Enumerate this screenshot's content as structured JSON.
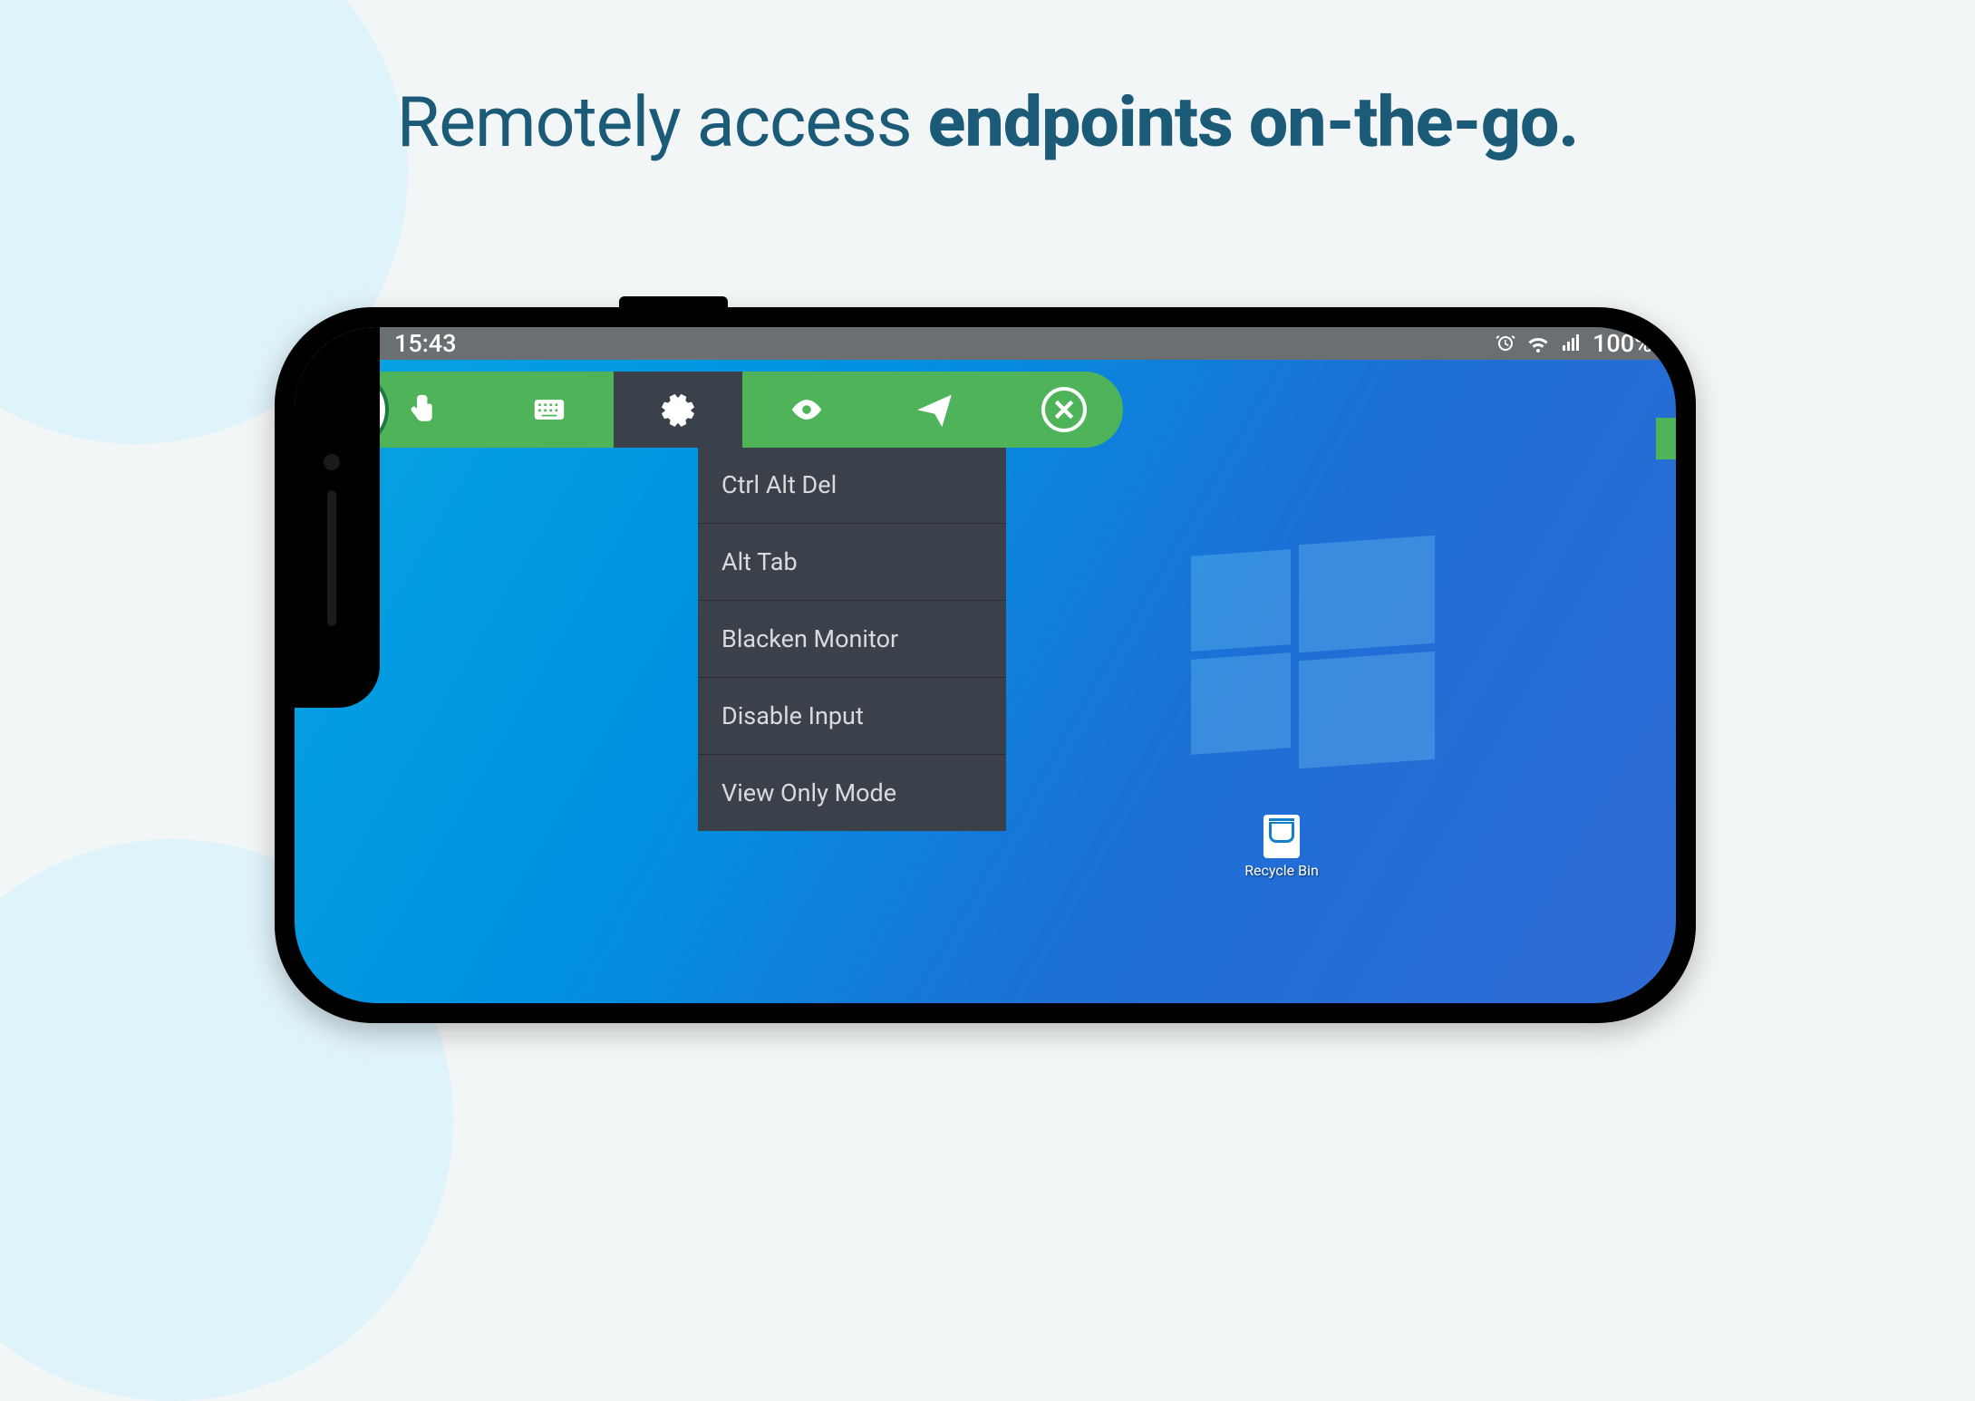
{
  "headline": {
    "prefix": "Remotely access ",
    "bold": "endpoints on-the-go."
  },
  "status": {
    "time": "15:43",
    "battery": "100%"
  },
  "toolbar": {
    "items": [
      "touch",
      "keyboard",
      "settings",
      "view",
      "send"
    ],
    "activeIndex": 2
  },
  "dropdown": {
    "items": [
      "Ctrl Alt Del",
      "Alt Tab",
      "Blacken Monitor",
      "Disable Input",
      "View Only Mode"
    ]
  },
  "desktop": {
    "recycle_bin_label": "Recycle Bin"
  }
}
